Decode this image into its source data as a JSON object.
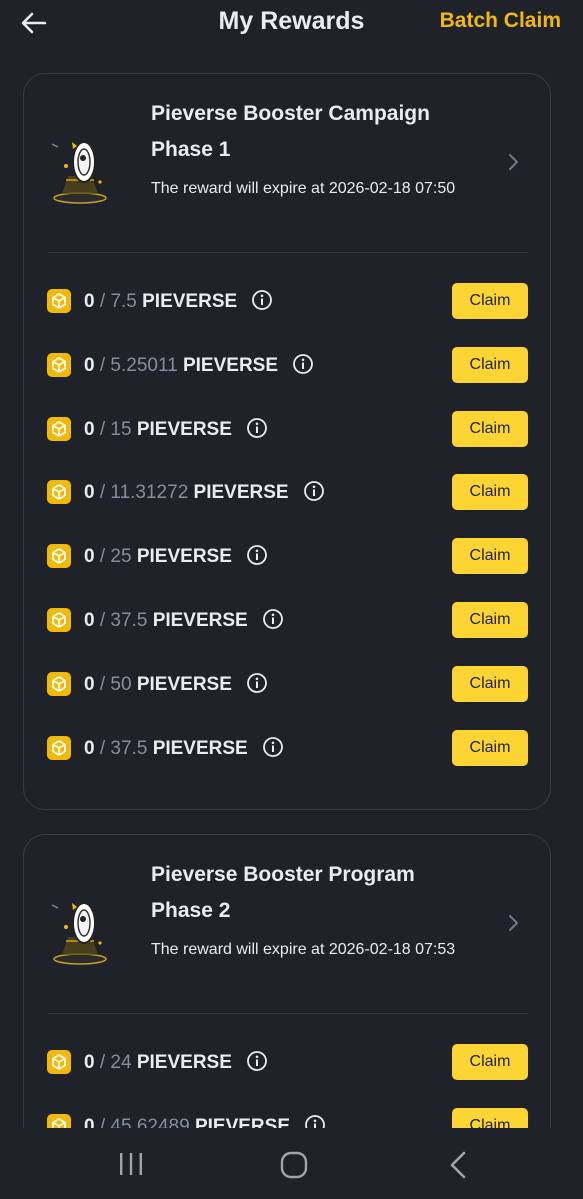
{
  "header": {
    "title": "My Rewards",
    "batch_claim_label": "Batch Claim",
    "back_icon": "arrow-left-icon"
  },
  "colors": {
    "background": "#1f2229",
    "accent": "#f0b90b",
    "button": "#fcd535",
    "muted_text": "#848e9c"
  },
  "campaigns": [
    {
      "title": "Pieverse Booster Campaign Phase 1",
      "expiry": "The reward will expire at 2026-02-18 07:50",
      "rewards": [
        {
          "claimed": "0",
          "total": "7.5",
          "token": "PIEVERSE",
          "button": "Claim"
        },
        {
          "claimed": "0",
          "total": "5.25011",
          "token": "PIEVERSE",
          "button": "Claim"
        },
        {
          "claimed": "0",
          "total": "15",
          "token": "PIEVERSE",
          "button": "Claim"
        },
        {
          "claimed": "0",
          "total": "11.31272",
          "token": "PIEVERSE",
          "button": "Claim"
        },
        {
          "claimed": "0",
          "total": "25",
          "token": "PIEVERSE",
          "button": "Claim"
        },
        {
          "claimed": "0",
          "total": "37.5",
          "token": "PIEVERSE",
          "button": "Claim"
        },
        {
          "claimed": "0",
          "total": "50",
          "token": "PIEVERSE",
          "button": "Claim"
        },
        {
          "claimed": "0",
          "total": "37.5",
          "token": "PIEVERSE",
          "button": "Claim"
        }
      ]
    },
    {
      "title": "Pieverse Booster Program Phase 2",
      "expiry": "The reward will expire at 2026-02-18 07:53",
      "rewards": [
        {
          "claimed": "0",
          "total": "24",
          "token": "PIEVERSE",
          "button": "Claim"
        },
        {
          "claimed": "0",
          "total": "45.62489",
          "token": "PIEVERSE",
          "button": "Claim"
        }
      ]
    }
  ],
  "nav": {
    "recent_icon": "recent-apps-icon",
    "home_icon": "home-icon",
    "back_icon": "back-chevron-icon"
  }
}
